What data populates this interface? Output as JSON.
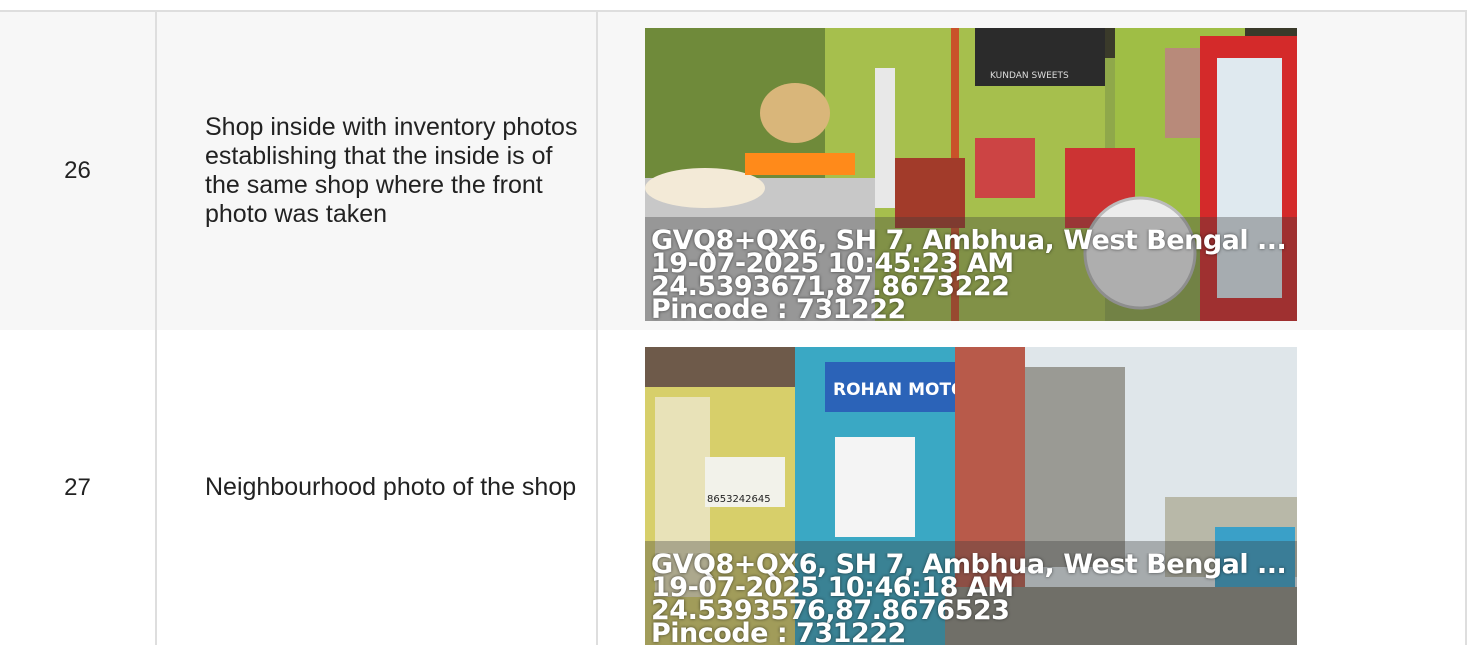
{
  "rows": [
    {
      "number": "26",
      "description": "Shop inside with inventory photos establishing that the inside is of the same shop where the front photo was taken",
      "photo": {
        "address": "GVQ8+QX6, SH 7, Ambhua, West Bengal ...",
        "datetime": "19-07-2025 10:45:23 AM",
        "coords": "24.5393671,87.8673222",
        "pincode": "Pincode : 731222",
        "sign_text": "KUNDAN SWEETS"
      }
    },
    {
      "number": "27",
      "description": "Neighbourhood photo of the shop",
      "photo": {
        "address": "GVQ8+QX6, SH 7, Ambhua, West Bengal ...",
        "datetime": "19-07-2025 10:46:18 AM",
        "coords": "24.5393576,87.8676523",
        "pincode": "Pincode : 731222",
        "sign_text": "ROHAN MOTOR",
        "phone_text": "8653242645"
      }
    }
  ]
}
